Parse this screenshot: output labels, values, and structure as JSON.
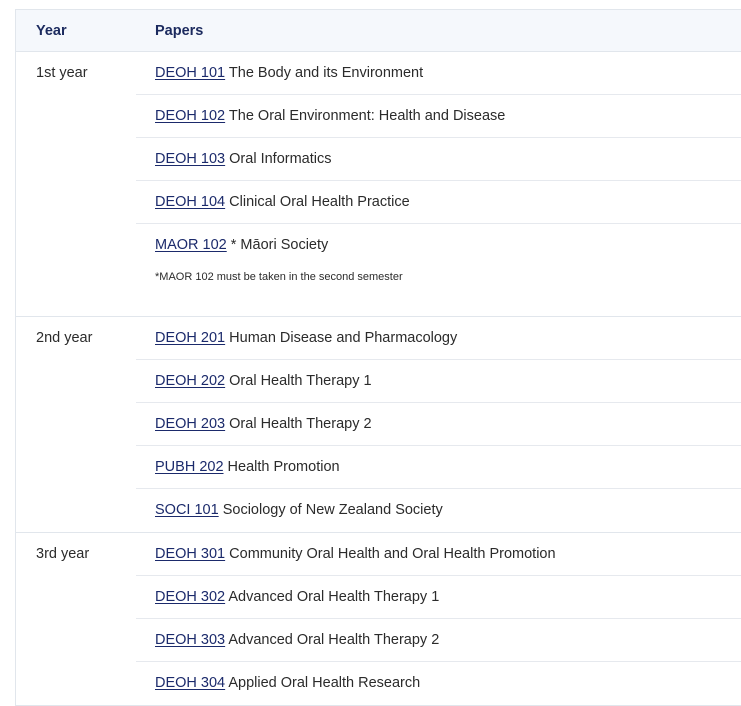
{
  "table": {
    "header": {
      "year": "Year",
      "papers": "Papers"
    },
    "groups": [
      {
        "year": "1st year",
        "papers": [
          {
            "code": "DEOH 101",
            "title": "The Body and its Environment"
          },
          {
            "code": "DEOH 102",
            "title": "The Oral Environment: Health and Disease"
          },
          {
            "code": "DEOH 103",
            "title": "Oral Informatics"
          },
          {
            "code": "DEOH 104",
            "title": "Clinical Oral Health Practice"
          },
          {
            "code": "MAOR 102",
            "title": "* Māori Society"
          }
        ],
        "note": "*MAOR 102 must be taken in the second semester"
      },
      {
        "year": "2nd year",
        "papers": [
          {
            "code": "DEOH 201",
            "title": "Human Disease and Pharmacology"
          },
          {
            "code": "DEOH 202",
            "title": "Oral Health Therapy 1"
          },
          {
            "code": "DEOH 203",
            "title": "Oral Health Therapy 2"
          },
          {
            "code": "PUBH 202",
            "title": "Health Promotion"
          },
          {
            "code": "SOCI 101",
            "title": "Sociology of New Zealand Society"
          }
        ]
      },
      {
        "year": "3rd year",
        "papers": [
          {
            "code": "DEOH 301",
            "title": "Community Oral Health and Oral Health Promotion"
          },
          {
            "code": "DEOH 302",
            "title": "Advanced Oral Health Therapy 1"
          },
          {
            "code": "DEOH 303",
            "title": "Advanced Oral Health Therapy 2"
          },
          {
            "code": "DEOH 304",
            "title": "Applied Oral Health Research"
          }
        ]
      }
    ]
  }
}
